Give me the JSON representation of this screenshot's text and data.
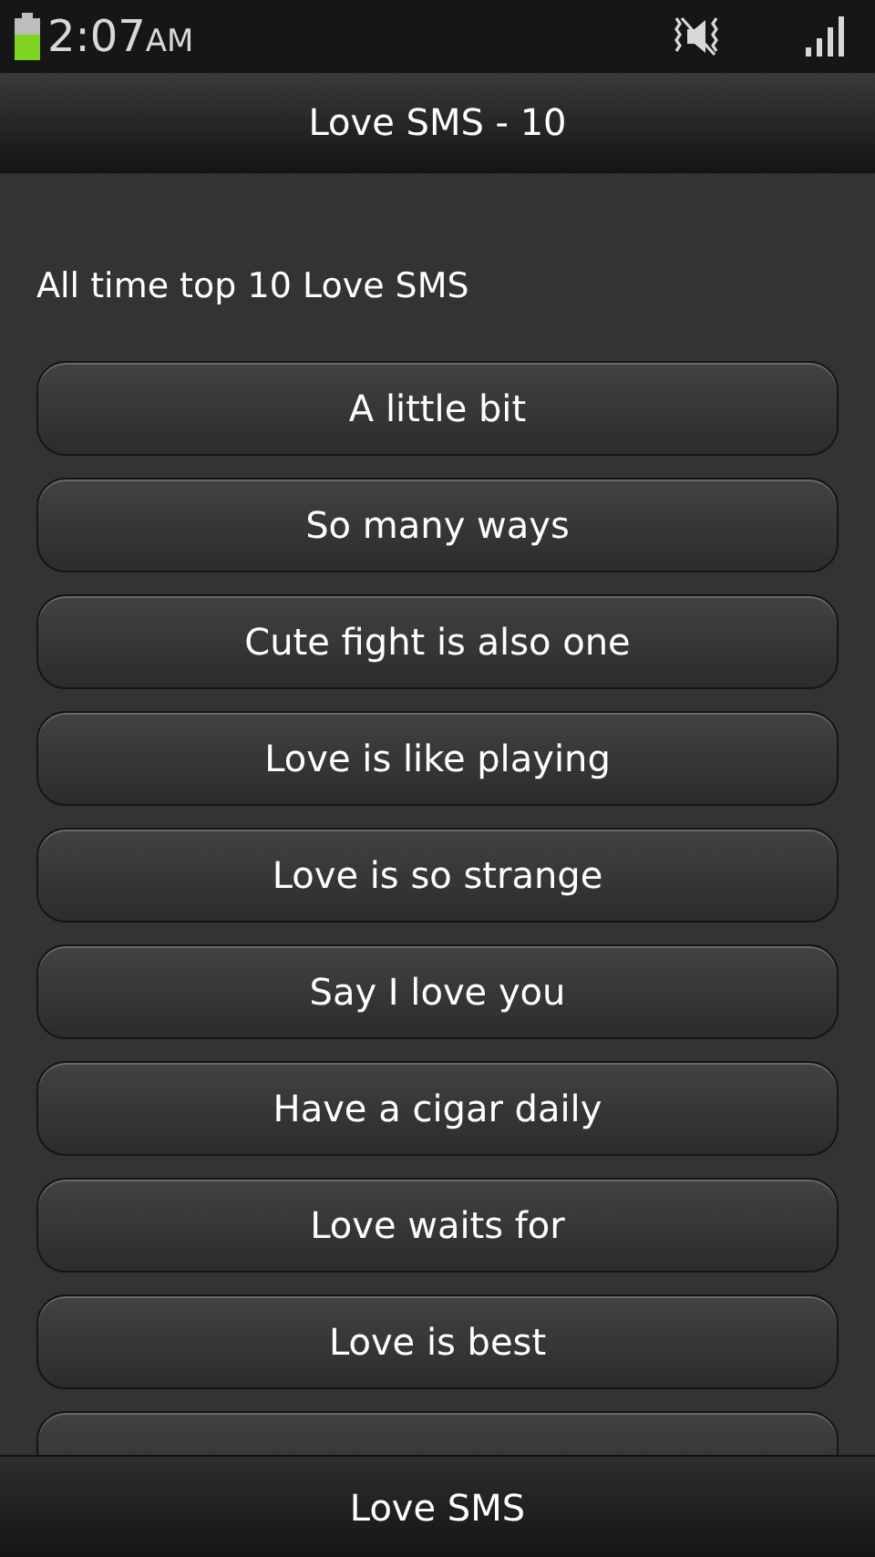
{
  "status_bar": {
    "time": "2:07",
    "ampm": "AM"
  },
  "title_bar": {
    "title": "Love SMS - 10"
  },
  "heading": "All time top 10 Love SMS",
  "items": [
    "A little bit",
    "So many ways",
    "Cute fight is also one",
    "Love is like playing",
    "Love is so strange",
    "Say I love you",
    "Have a cigar daily",
    "Love waits for",
    "Love is best"
  ],
  "bottom_bar": {
    "label": "Love SMS"
  }
}
